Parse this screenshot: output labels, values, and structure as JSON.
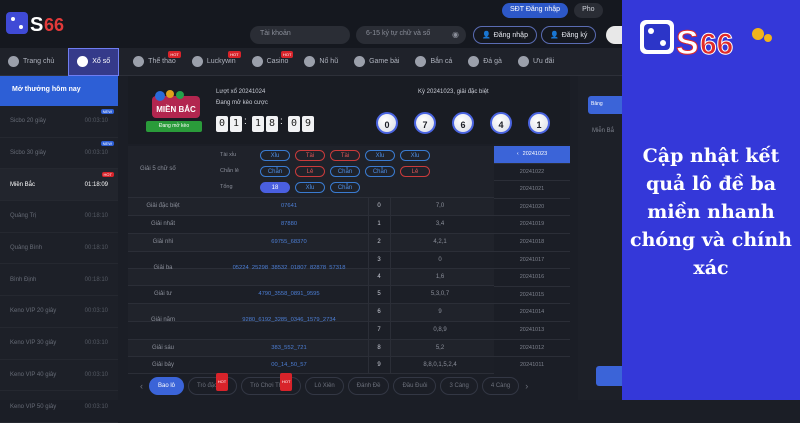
{
  "top": {
    "login_tabs": [
      "SĐT Đăng nhập",
      "Pho"
    ],
    "account_placeholder": "Tài khoản",
    "password_placeholder": "6-15 ký tự chữ và số",
    "login_btn": "Đăng nhập",
    "register_btn": "Đăng ký"
  },
  "nav": {
    "items": [
      {
        "label": "Trang chủ",
        "hot": false
      },
      {
        "label": "Xổ số",
        "hot": false,
        "active": true
      },
      {
        "label": "Thể thao",
        "hot": true
      },
      {
        "label": "Luckywin",
        "hot": true
      },
      {
        "label": "Casino",
        "hot": true
      },
      {
        "label": "Nổ hũ",
        "hot": false
      },
      {
        "label": "Game bài",
        "hot": false
      },
      {
        "label": "Bắn cá",
        "hot": false
      },
      {
        "label": "Đá gà",
        "hot": false
      },
      {
        "label": "Ưu đãi",
        "hot": false
      }
    ],
    "hot_label": "HOT"
  },
  "sidebar": {
    "header": "Mở thưởng hôm nay",
    "new_label": "NEW",
    "hot_label": "HOT",
    "items": [
      {
        "name": "Sicbo 20 giây",
        "time": "00:03:10",
        "badge": "new"
      },
      {
        "name": "Sicbo 30 giây",
        "time": "00:03:10",
        "badge": "new"
      },
      {
        "name": "Miền Bắc",
        "time": "01:18:09",
        "badge": "hot",
        "active": true
      },
      {
        "name": "Quảng Trị",
        "time": "00:18:10",
        "badge": ""
      },
      {
        "name": "Quảng Bình",
        "time": "00:18:10",
        "badge": ""
      },
      {
        "name": "Bình Định",
        "time": "00:18:10",
        "badge": ""
      },
      {
        "name": "Keno VIP 20 giây",
        "time": "00:03:10",
        "badge": ""
      },
      {
        "name": "Keno VIP 30 giây",
        "time": "00:03:10",
        "badge": ""
      },
      {
        "name": "Keno VIP 40 giây",
        "time": "00:03:10",
        "badge": ""
      },
      {
        "name": "Keno VIP 50 giây",
        "time": "00:03:10",
        "badge": ""
      }
    ]
  },
  "draw": {
    "badge_text": "MIỀN BẮC",
    "open_btn": "Đang mở kèo",
    "turn_line": "Lượt xổ 20241024",
    "status_line": "Đang mở kèo cược",
    "countdown": [
      "0",
      "1",
      "1",
      "8",
      "0",
      "9"
    ],
    "result_title": "Kỳ 20241023, giải đặc biệt",
    "balls": [
      "0",
      "7",
      "6",
      "4",
      "1"
    ]
  },
  "summary": {
    "label": "Giải 5 chữ số",
    "rows": [
      {
        "label": "Tài xỉu",
        "chips": [
          {
            "t": "Xỉu",
            "c": "blue"
          },
          {
            "t": "Tài",
            "c": "red"
          },
          {
            "t": "Tài",
            "c": "red"
          },
          {
            "t": "Xỉu",
            "c": "blue"
          },
          {
            "t": "Xỉu",
            "c": "blue"
          }
        ]
      },
      {
        "label": "Chẵn lẻ",
        "chips": [
          {
            "t": "Chẵn",
            "c": "blue"
          },
          {
            "t": "Lẻ",
            "c": "red"
          },
          {
            "t": "Chẵn",
            "c": "blue"
          },
          {
            "t": "Chẵn",
            "c": "blue"
          },
          {
            "t": "Lẻ",
            "c": "red"
          }
        ]
      },
      {
        "label": "Tổng",
        "chips": [
          {
            "t": "18",
            "c": "solid"
          },
          {
            "t": "Xỉu",
            "c": "blue"
          },
          {
            "t": "Chẵn",
            "c": "blue"
          }
        ]
      }
    ]
  },
  "prizes": [
    {
      "name": "Giải đặc biệt",
      "numbers": "07641",
      "head": "0",
      "tail": "7,0"
    },
    {
      "name": "Giải nhất",
      "numbers": "87880",
      "head": "1",
      "tail": "3,4"
    },
    {
      "name": "Giải nhì",
      "numbers": "69755_68370",
      "head": "2",
      "tail": "4,2,1"
    },
    {
      "name": "Giải ba",
      "numbers": "05224_25298_38532_01807_82878_57318",
      "head": "3",
      "tail": "0"
    },
    {
      "name": "",
      "numbers": "",
      "head": "4",
      "tail": "1,6"
    },
    {
      "name": "Giải tư",
      "numbers": "4790_3558_0891_9595",
      "head": "5",
      "tail": "5,3,0,7"
    },
    {
      "name": "Giải năm",
      "numbers": "9280_6192_3285_0346_1579_2734",
      "head": "6",
      "tail": "9"
    },
    {
      "name": "",
      "numbers": "",
      "head": "7",
      "tail": "0,8,9"
    },
    {
      "name": "Giải sáu",
      "numbers": "383_552_721",
      "head": "8",
      "tail": "5,2"
    },
    {
      "name": "Giải bảy",
      "numbers": "00_14_50_57",
      "head": "9",
      "tail": "8,8,0,1,5,2,4"
    }
  ],
  "dates": [
    "20241023",
    "20241022",
    "20241021",
    "20241020",
    "20241019",
    "20241018",
    "20241017",
    "20241016",
    "20241015",
    "20241014",
    "20241013",
    "20241012",
    "20241011"
  ],
  "bottom_tabs": [
    {
      "label": "Bao lô",
      "active": true,
      "hot": false
    },
    {
      "label": "Trò đặc sắc",
      "hot": true
    },
    {
      "label": "Trò Chơi Thú Vị",
      "hot": true
    },
    {
      "label": "Lô Xiên",
      "hot": false
    },
    {
      "label": "Đánh Đề",
      "hot": false
    },
    {
      "label": "Đầu Đuôi",
      "hot": false
    },
    {
      "label": "3 Càng",
      "hot": false
    },
    {
      "label": "4 Càng",
      "hot": false
    }
  ],
  "right_panel": {
    "btn": "Bảng",
    "label": "Miễn Bắ"
  },
  "banner": {
    "logo_text": "S6S66",
    "headline": "Cập nhật kết quả lô đề ba miền nhanh chóng và chính xác"
  }
}
